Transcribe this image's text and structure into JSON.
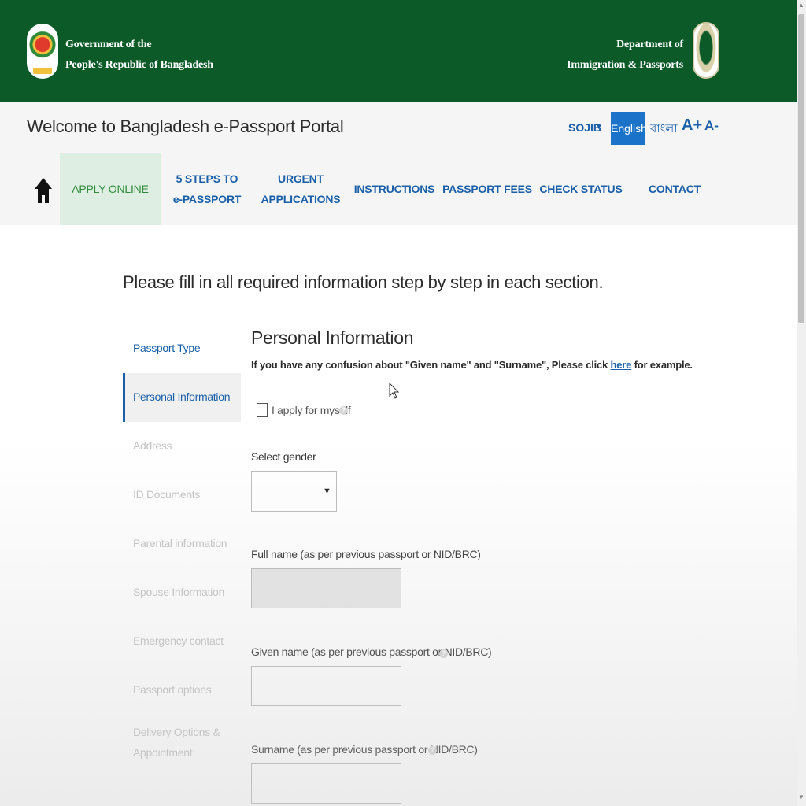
{
  "header": {
    "gov_line1": "Government of the",
    "gov_line2": "People's Republic of Bangladesh",
    "dept_line1": "Department of",
    "dept_line2": "Immigration & Passports",
    "brand_green": "#0b5a28"
  },
  "topbar": {
    "title": "Welcome to Bangladesh e-Passport Portal",
    "user": "SOJIB",
    "lang_english": "English",
    "lang_bangla": "বাংলা",
    "font_increase": "A+",
    "font_decrease": "A-"
  },
  "nav": {
    "home_icon": "home-icon",
    "items": [
      {
        "label": "APPLY ONLINE",
        "active": true
      },
      {
        "label": "5 STEPS TO\ne-PASSPORT"
      },
      {
        "label": "URGENT\nAPPLICATIONS"
      },
      {
        "label": "INSTRUCTIONS"
      },
      {
        "label": "PASSPORT FEES"
      },
      {
        "label": "CHECK STATUS"
      },
      {
        "label": "CONTACT"
      }
    ]
  },
  "main": {
    "instruction": "Please fill in all required information step by step in each section.",
    "steps": [
      "Passport Type",
      "Personal Information",
      "Address",
      "ID Documents",
      "Parental information",
      "Spouse Information",
      "Emergency contact",
      "Passport options",
      "Delivery Options &",
      "Appointment"
    ],
    "section_title": "Personal Information",
    "confusion_prefix": "If you have any confusion about \"Given name\" and \"Surname\", Please click ",
    "confusion_link": "here",
    "confusion_suffix": " for example.",
    "apply_myself": "I apply for myself",
    "gender_label": "Select gender",
    "gender_value": "",
    "full_name_label": "Full name (as per previous passport or NID/BRC)",
    "full_name_value": "",
    "given_name_label": "Given name (as per previous passport or NID/BRC)",
    "given_name_value": "",
    "surname_label": "Surname (as per previous passport or NID/BRC)",
    "surname_value": ""
  }
}
